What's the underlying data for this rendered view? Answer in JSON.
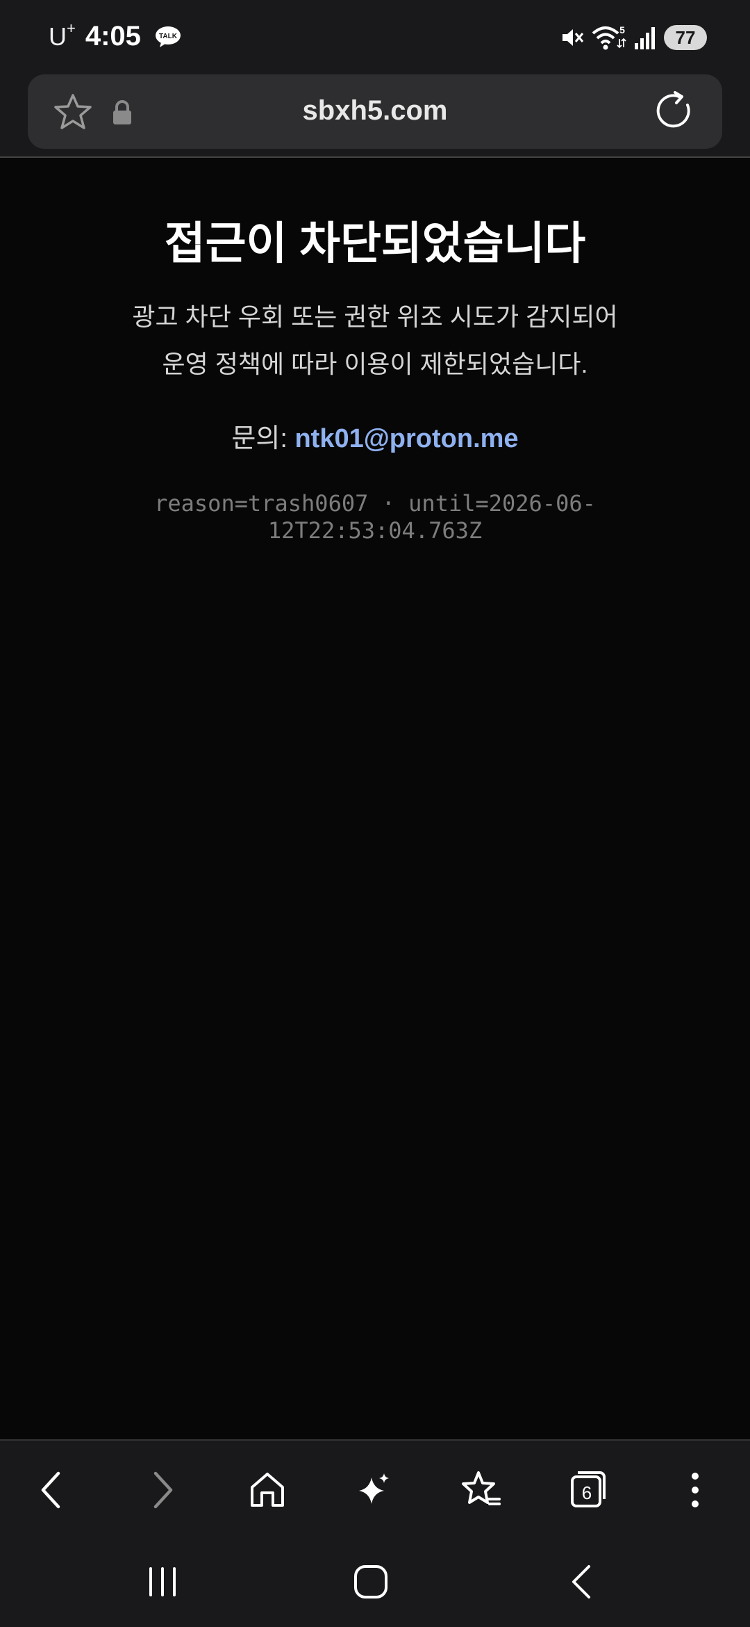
{
  "status_bar": {
    "carrier": "U",
    "carrier_sup": "+",
    "time": "4:05",
    "notification_icon": "kakaotalk-icon",
    "talk_label": "TALK",
    "wifi_badge": "5",
    "battery": "77"
  },
  "browser": {
    "url": "sbxh5.com",
    "tab_count": "6"
  },
  "page": {
    "title": "접근이 차단되었습니다",
    "message_line1": "광고 차단 우회 또는 권한 위조 시도가 감지되어",
    "message_line2": "운영 정책에 따라 이용이 제한되었습니다.",
    "contact_label": "문의: ",
    "contact_email": "ntk01@proton.me",
    "reason_line1": "reason=trash0607 · until=2026-06-",
    "reason_line2": "12T22:53:04.763Z"
  },
  "colors": {
    "background": "#070707",
    "chrome": "#19191b",
    "link": "#8fb1f0"
  }
}
